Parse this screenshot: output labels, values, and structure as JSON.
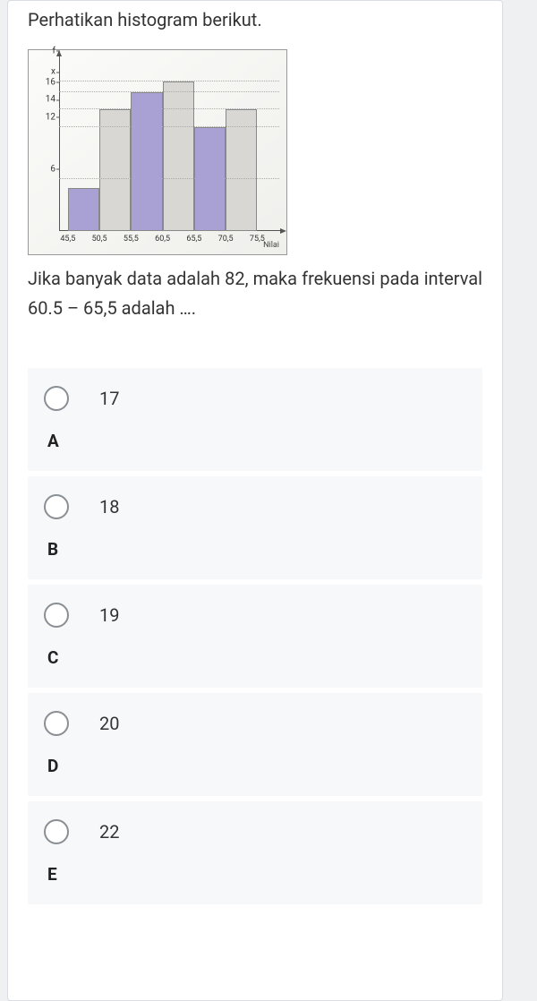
{
  "intro": "Perhatikan histogram berikut.",
  "question": "Jika banyak data adalah 82, maka frekuensi pada interval 60.5 – 65,5 adalah ….",
  "chart_data": {
    "type": "bar",
    "title": "",
    "xlabel": "Nilai",
    "ylabel": "f",
    "categories": [
      "45,5",
      "50,5",
      "55,5",
      "60,5",
      "65,5",
      "70,5",
      "75,5"
    ],
    "y_ticks": [
      6,
      12,
      14,
      16,
      "x"
    ],
    "ylim": [
      0,
      20
    ],
    "values": [
      5,
      14,
      16,
      "x",
      12,
      14
    ],
    "colors": [
      "purple",
      "grey",
      "purple",
      "grey",
      "purple",
      "grey"
    ]
  },
  "options": [
    {
      "letter": "A",
      "value": "17"
    },
    {
      "letter": "B",
      "value": "18"
    },
    {
      "letter": "C",
      "value": "19"
    },
    {
      "letter": "D",
      "value": "20"
    },
    {
      "letter": "E",
      "value": "22"
    }
  ]
}
